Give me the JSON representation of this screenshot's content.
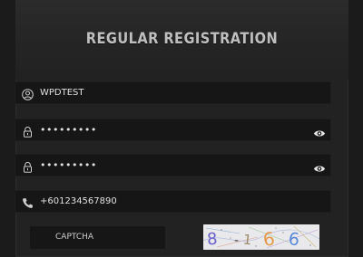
{
  "form": {
    "title": "REGULAR REGISTRATION",
    "username": "WPDTEST",
    "password": "•••••••••",
    "confirm_password": "•••••••••",
    "phone": "+601234567890",
    "captcha_placeholder": "CAPTCHA",
    "captcha_code": "8166"
  },
  "icons": {
    "username": "user-icon",
    "password": "lock-icon",
    "confirm_password": "lock-icon",
    "password_toggle": "eye-icon",
    "phone": "phone-icon"
  }
}
